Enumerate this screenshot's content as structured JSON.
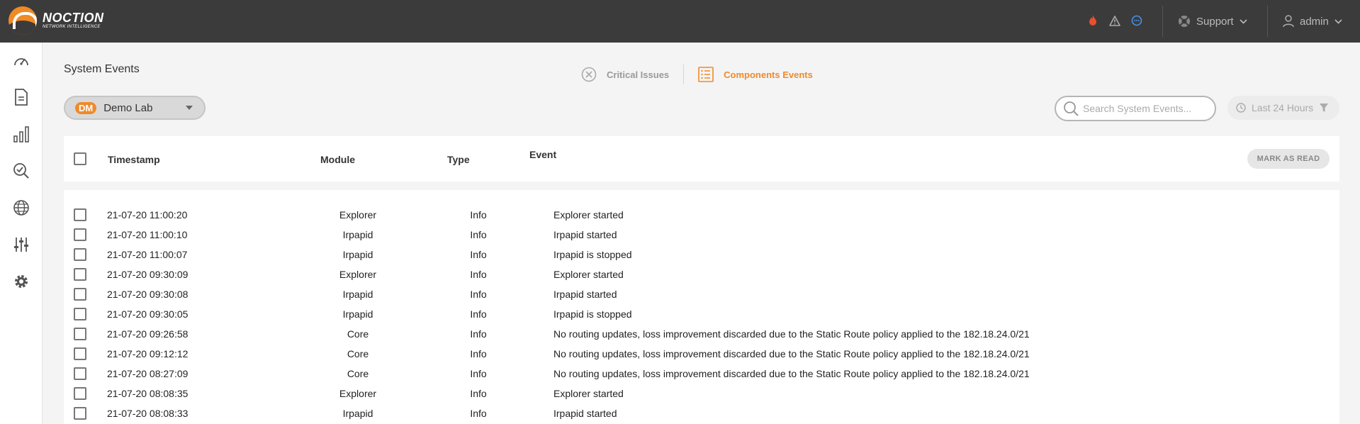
{
  "brand": {
    "name": "NOCTION",
    "tagline": "NETWORK INTELLIGENCE"
  },
  "topbar": {
    "icons": [
      "fire-icon",
      "warning-icon",
      "chat-icon"
    ],
    "support_label": "Support",
    "user_label": "admin"
  },
  "sidebar": {
    "items": [
      "dashboard-icon",
      "reports-icon",
      "charts-icon",
      "search-check-icon",
      "globe-icon",
      "sliders-icon",
      "gear-icon"
    ]
  },
  "page": {
    "title": "System Events",
    "tabs": [
      {
        "label": "Critical Issues",
        "active": false
      },
      {
        "label": "Components Events",
        "active": true
      }
    ]
  },
  "filters": {
    "lab_badge": "DM",
    "lab_name": "Demo Lab",
    "search_placeholder": "Search System Events...",
    "time_range": "Last 24 Hours"
  },
  "table": {
    "headers": {
      "timestamp": "Timestamp",
      "module": "Module",
      "type": "Type",
      "event": "Event"
    },
    "mark_read_label": "MARK AS READ",
    "rows": [
      {
        "timestamp": "21-07-20 11:00:20",
        "module": "Explorer",
        "type": "Info",
        "event": "Explorer started"
      },
      {
        "timestamp": "21-07-20 11:00:10",
        "module": "Irpapid",
        "type": "Info",
        "event": "Irpapid started"
      },
      {
        "timestamp": "21-07-20 11:00:07",
        "module": "Irpapid",
        "type": "Info",
        "event": "Irpapid is stopped"
      },
      {
        "timestamp": "21-07-20 09:30:09",
        "module": "Explorer",
        "type": "Info",
        "event": "Explorer started"
      },
      {
        "timestamp": "21-07-20 09:30:08",
        "module": "Irpapid",
        "type": "Info",
        "event": "Irpapid started"
      },
      {
        "timestamp": "21-07-20 09:30:05",
        "module": "Irpapid",
        "type": "Info",
        "event": "Irpapid is stopped"
      },
      {
        "timestamp": "21-07-20 09:26:58",
        "module": "Core",
        "type": "Info",
        "event": "No routing updates, loss improvement discarded due to the Static Route policy applied to the 182.18.24.0/21"
      },
      {
        "timestamp": "21-07-20 09:12:12",
        "module": "Core",
        "type": "Info",
        "event": "No routing updates, loss improvement discarded due to the Static Route policy applied to the 182.18.24.0/21"
      },
      {
        "timestamp": "21-07-20 08:27:09",
        "module": "Core",
        "type": "Info",
        "event": "No routing updates, loss improvement discarded due to the Static Route policy applied to the 182.18.24.0/21"
      },
      {
        "timestamp": "21-07-20 08:08:35",
        "module": "Explorer",
        "type": "Info",
        "event": "Explorer started"
      },
      {
        "timestamp": "21-07-20 08:08:33",
        "module": "Irpapid",
        "type": "Info",
        "event": "Irpapid started"
      }
    ]
  },
  "colors": {
    "accent": "#ef8a2a",
    "topbar": "#3b3b3b",
    "fire": "#e8502e",
    "chat": "#4a90e2"
  }
}
